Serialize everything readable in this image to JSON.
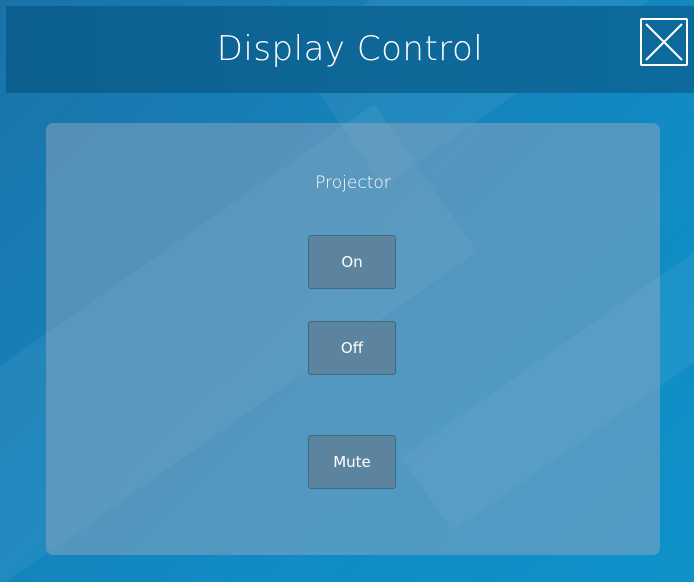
{
  "header": {
    "title": "Display Control",
    "close_icon": "close-icon"
  },
  "panel": {
    "section_label": "Projector",
    "buttons": {
      "on": "On",
      "off": "Off",
      "mute": "Mute"
    }
  },
  "colors": {
    "background_start": "#1a73a8",
    "background_end": "#0e92c9",
    "header": "#0e6797",
    "panel": "#8fa4b8",
    "button": "#5d849e",
    "text": "#ffffff"
  }
}
